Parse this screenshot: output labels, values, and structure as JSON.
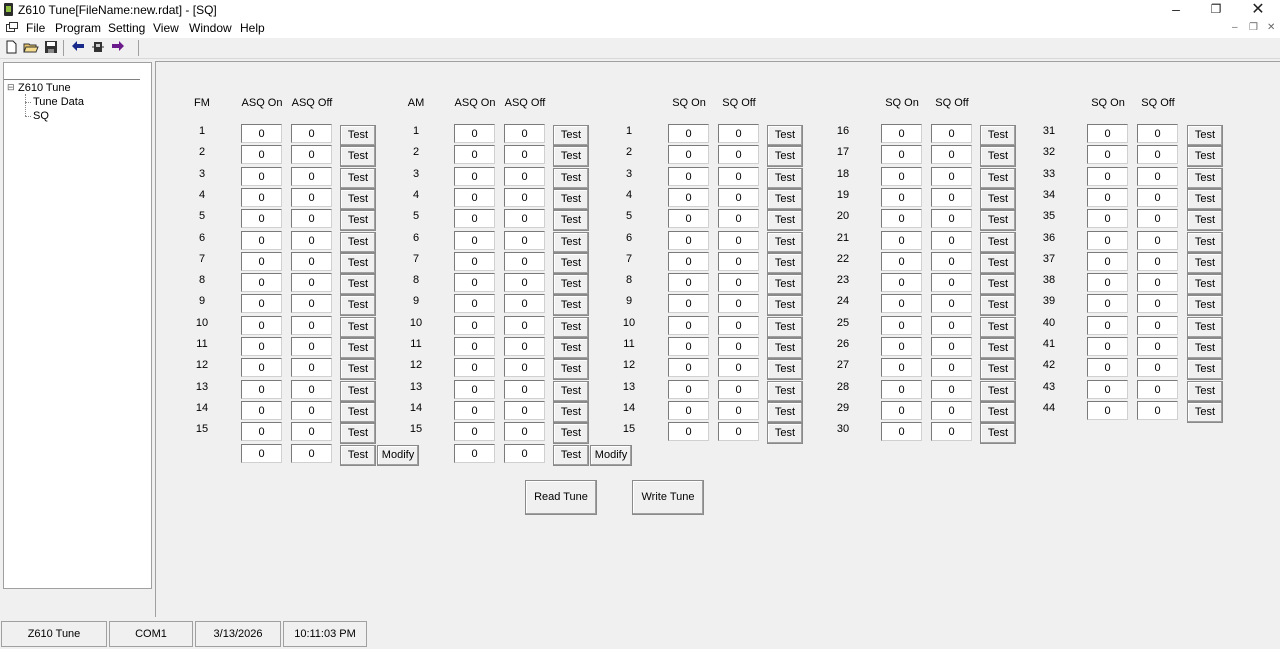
{
  "window": {
    "title": "Z610 Tune[FileName:new.rdat] - [SQ]"
  },
  "menu": [
    "File",
    "Program",
    "Setting",
    "View",
    "Window",
    "Help"
  ],
  "tree": {
    "root": "Z610 Tune",
    "children": [
      "Tune Data",
      "SQ"
    ],
    "expander": "⊟"
  },
  "fm": {
    "header": "FM",
    "on_label": "ASQ On",
    "off_label": "ASQ Off",
    "rows": [
      "1",
      "2",
      "3",
      "4",
      "5",
      "6",
      "7",
      "8",
      "9",
      "10",
      "11",
      "12",
      "13",
      "14",
      "15"
    ],
    "on": [
      "0",
      "0",
      "0",
      "0",
      "0",
      "0",
      "0",
      "0",
      "0",
      "0",
      "0",
      "0",
      "0",
      "0",
      "0",
      "0"
    ],
    "off": [
      "0",
      "0",
      "0",
      "0",
      "0",
      "0",
      "0",
      "0",
      "0",
      "0",
      "0",
      "0",
      "0",
      "0",
      "0",
      "0"
    ]
  },
  "am": {
    "header": "AM",
    "on_label": "ASQ On",
    "off_label": "ASQ Off",
    "rows": [
      "1",
      "2",
      "3",
      "4",
      "5",
      "6",
      "7",
      "8",
      "9",
      "10",
      "11",
      "12",
      "13",
      "14",
      "15"
    ],
    "on": [
      "0",
      "0",
      "0",
      "0",
      "0",
      "0",
      "0",
      "0",
      "0",
      "0",
      "0",
      "0",
      "0",
      "0",
      "0",
      "0"
    ],
    "off": [
      "0",
      "0",
      "0",
      "0",
      "0",
      "0",
      "0",
      "0",
      "0",
      "0",
      "0",
      "0",
      "0",
      "0",
      "0",
      "0"
    ]
  },
  "sq1": {
    "header": "",
    "on_label": "SQ On",
    "off_label": "SQ Off",
    "rows": [
      "1",
      "2",
      "3",
      "4",
      "5",
      "6",
      "7",
      "8",
      "9",
      "10",
      "11",
      "12",
      "13",
      "14",
      "15"
    ],
    "on": [
      "0",
      "0",
      "0",
      "0",
      "0",
      "0",
      "0",
      "0",
      "0",
      "0",
      "0",
      "0",
      "0",
      "0",
      "0"
    ],
    "off": [
      "0",
      "0",
      "0",
      "0",
      "0",
      "0",
      "0",
      "0",
      "0",
      "0",
      "0",
      "0",
      "0",
      "0",
      "0"
    ]
  },
  "sq2": {
    "header": "",
    "on_label": "SQ On",
    "off_label": "SQ Off",
    "rows": [
      "16",
      "17",
      "18",
      "19",
      "20",
      "21",
      "22",
      "23",
      "24",
      "25",
      "26",
      "27",
      "28",
      "29",
      "30"
    ],
    "on": [
      "0",
      "0",
      "0",
      "0",
      "0",
      "0",
      "0",
      "0",
      "0",
      "0",
      "0",
      "0",
      "0",
      "0",
      "0"
    ],
    "off": [
      "0",
      "0",
      "0",
      "0",
      "0",
      "0",
      "0",
      "0",
      "0",
      "0",
      "0",
      "0",
      "0",
      "0",
      "0"
    ]
  },
  "sq3": {
    "header": "",
    "on_label": "SQ On",
    "off_label": "SQ Off",
    "rows": [
      "31",
      "32",
      "33",
      "34",
      "35",
      "36",
      "37",
      "38",
      "39",
      "40",
      "41",
      "42",
      "43",
      "44"
    ],
    "on": [
      "0",
      "0",
      "0",
      "0",
      "0",
      "0",
      "0",
      "0",
      "0",
      "0",
      "0",
      "0",
      "0",
      "0"
    ],
    "off": [
      "0",
      "0",
      "0",
      "0",
      "0",
      "0",
      "0",
      "0",
      "0",
      "0",
      "0",
      "0",
      "0",
      "0"
    ]
  },
  "buttons": {
    "test": "Test",
    "modify": "Modify",
    "read_tune": "Read Tune",
    "write_tune": "Write Tune"
  },
  "status": {
    "app": "Z610 Tune",
    "port": "COM1",
    "date": "3/13/2026",
    "time": "10:11:03 PM"
  }
}
